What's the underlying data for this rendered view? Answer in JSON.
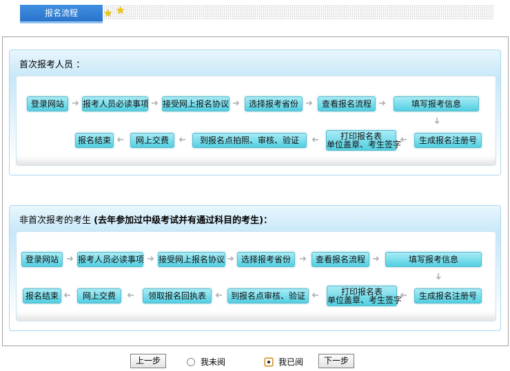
{
  "header": {
    "tab_label": "报名流程"
  },
  "section1": {
    "title": "首次报考人员 ：",
    "row1": [
      "登录网站",
      "报考人员必读事项",
      "接受网上报名协议",
      "选择报考省份",
      "查看报名流程",
      "填写报考信息"
    ],
    "row2": [
      "报名结束",
      "网上交费",
      "到报名点拍照、审核、验证",
      "打印报名表",
      "单位盖章、考生签字",
      "生成报名注册号"
    ]
  },
  "section2": {
    "title_plain": "非首次报考的考生",
    "title_bold": "(去年参加过中级考试并有通过科目的考生)：",
    "row1": [
      "登录网站",
      "报考人员必读事项",
      "接受网上报名协议",
      "选择报考省份",
      "查看报名流程",
      "填写报考信息"
    ],
    "row2": [
      "报名结束",
      "网上交费",
      "领取报名回执表",
      "到报名点审核、验证",
      "打印报名表",
      "单位盖章、考生签字",
      "生成报名注册号"
    ]
  },
  "nav": {
    "prev_label": "上一步",
    "not_read_label": "我未阅",
    "read_label": "我已阅",
    "next_label": "下一步",
    "selected": "read"
  },
  "colors": {
    "step_bg": "#7ddcea",
    "tab_bg": "#2f7ed8",
    "panel_border": "#a9d6ef"
  }
}
